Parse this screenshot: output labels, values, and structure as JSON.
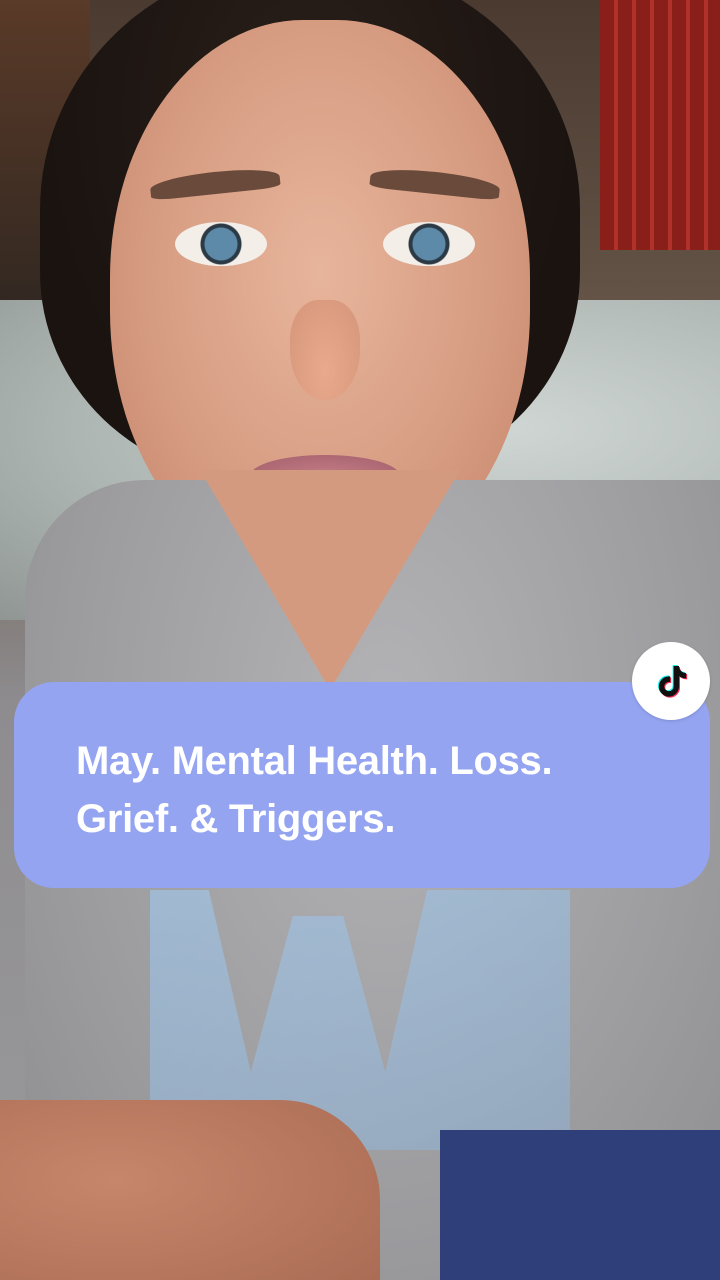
{
  "caption": {
    "line1": "May. Mental Health. Loss.",
    "line2": "Grief. & Triggers.",
    "background_color": "#94a4f1",
    "text_color": "#ffffff"
  },
  "badge": {
    "icon": "tiktok-logo-icon",
    "background_color": "#ffffff"
  }
}
